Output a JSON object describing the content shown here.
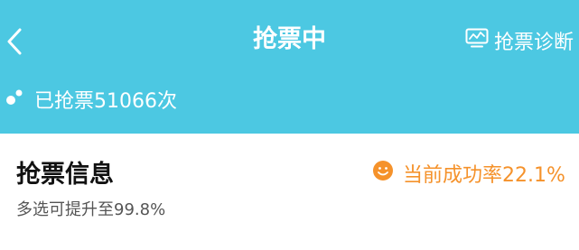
{
  "header": {
    "title": "抢票中",
    "diagnose_label": "抢票诊断",
    "status_text": "已抢票51066次",
    "background_color": "#4cc8e2",
    "back_icon": "chevron-left-icon",
    "diagnose_icon": "chart-monitor-icon",
    "status_icon": "bubbles-icon"
  },
  "info": {
    "title": "抢票信息",
    "subtitle": "多选可提升至99.8%",
    "success_rate": "当前成功率22.1%",
    "success_icon": "smile-icon",
    "accent_color": "#f5922b"
  }
}
